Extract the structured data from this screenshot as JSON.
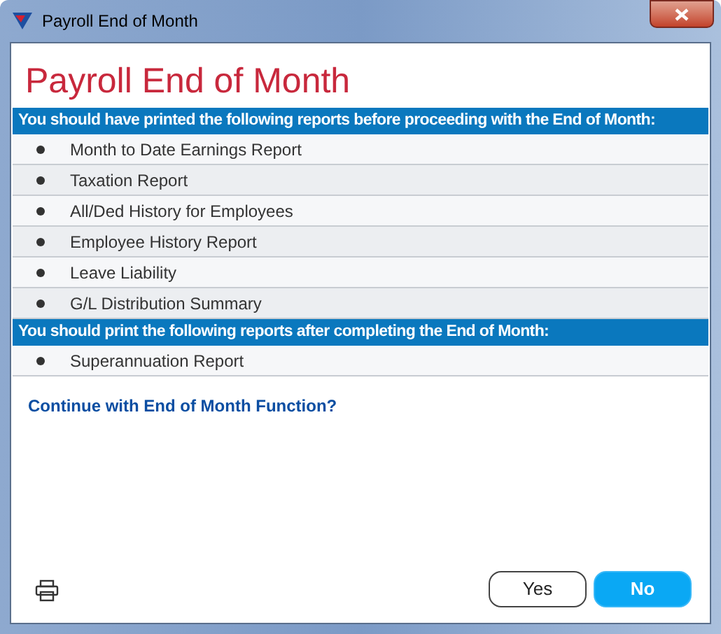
{
  "window": {
    "title": "Payroll End of Month"
  },
  "heading": "Payroll End of Month",
  "sections": [
    {
      "banner": "You should have printed the following reports before proceeding with the End of Month:",
      "items": [
        "Month to Date Earnings Report",
        "Taxation Report",
        "All/Ded History for Employees",
        "Employee History Report",
        "Leave Liability",
        "G/L Distribution Summary"
      ]
    },
    {
      "banner": "You should print the following reports after completing the End of Month:",
      "items": [
        "Superannuation Report"
      ]
    }
  ],
  "question": "Continue with End of Month Function?",
  "buttons": [
    {
      "label": "Yes",
      "selected": false
    },
    {
      "label": "No",
      "selected": true
    }
  ]
}
